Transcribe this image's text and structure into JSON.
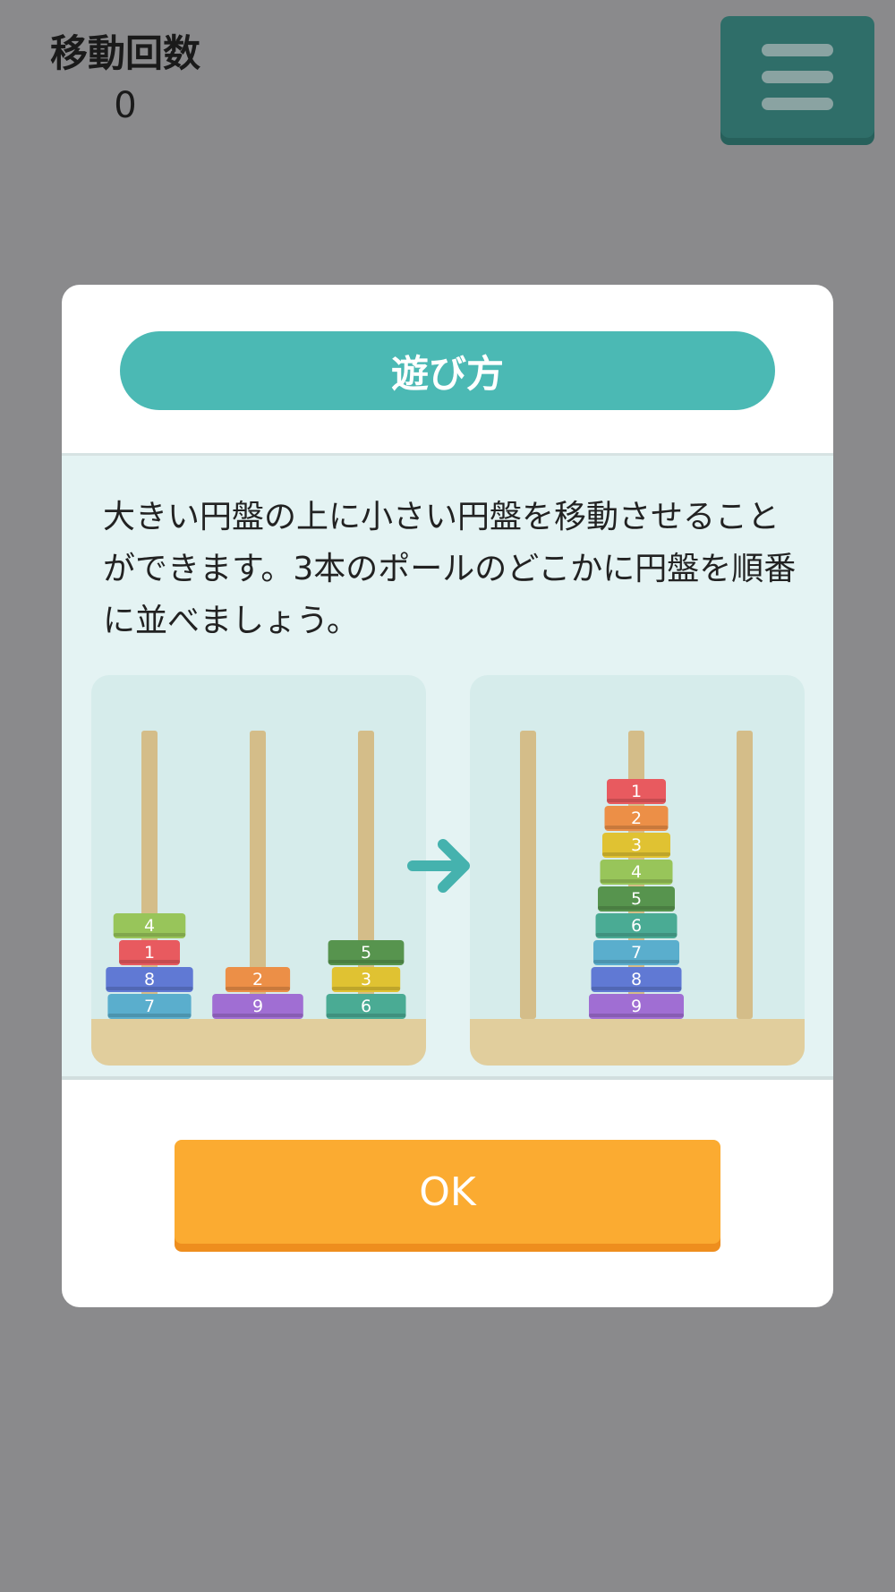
{
  "header": {
    "move_label": "移動回数",
    "move_count": "0",
    "menu_icon": "hamburger-menu-icon"
  },
  "modal": {
    "title": "遊び方",
    "description": "大きい円盤の上に小さい円盤を移動させることができます。3本のポールのどこかに円盤を順番に並べましょう。",
    "ok_label": "OK"
  },
  "illustration": {
    "arrow_icon": "right-arrow-icon",
    "disc_colors": {
      "1": "#e85a5f",
      "2": "#ec8f47",
      "3": "#e0c232",
      "4": "#98c55a",
      "5": "#57944e",
      "6": "#4aab94",
      "7": "#5aaecd",
      "8": "#6079d4",
      "9": "#a06ed3"
    },
    "before": {
      "poles": [
        [
          "7",
          "8",
          "1",
          "4"
        ],
        [
          "9",
          "2"
        ],
        [
          "6",
          "3",
          "5"
        ]
      ]
    },
    "after": {
      "poles": [
        [],
        [
          "9",
          "8",
          "7",
          "6",
          "5",
          "4",
          "3",
          "2",
          "1"
        ],
        []
      ]
    }
  },
  "colors": {
    "background": "#8a8a8c",
    "accent_teal": "#4bb9b4",
    "menu_button": "#2f6e69",
    "ok_button": "#fbab31",
    "pole": "#d4bd89",
    "base": "#e1ce9d"
  }
}
